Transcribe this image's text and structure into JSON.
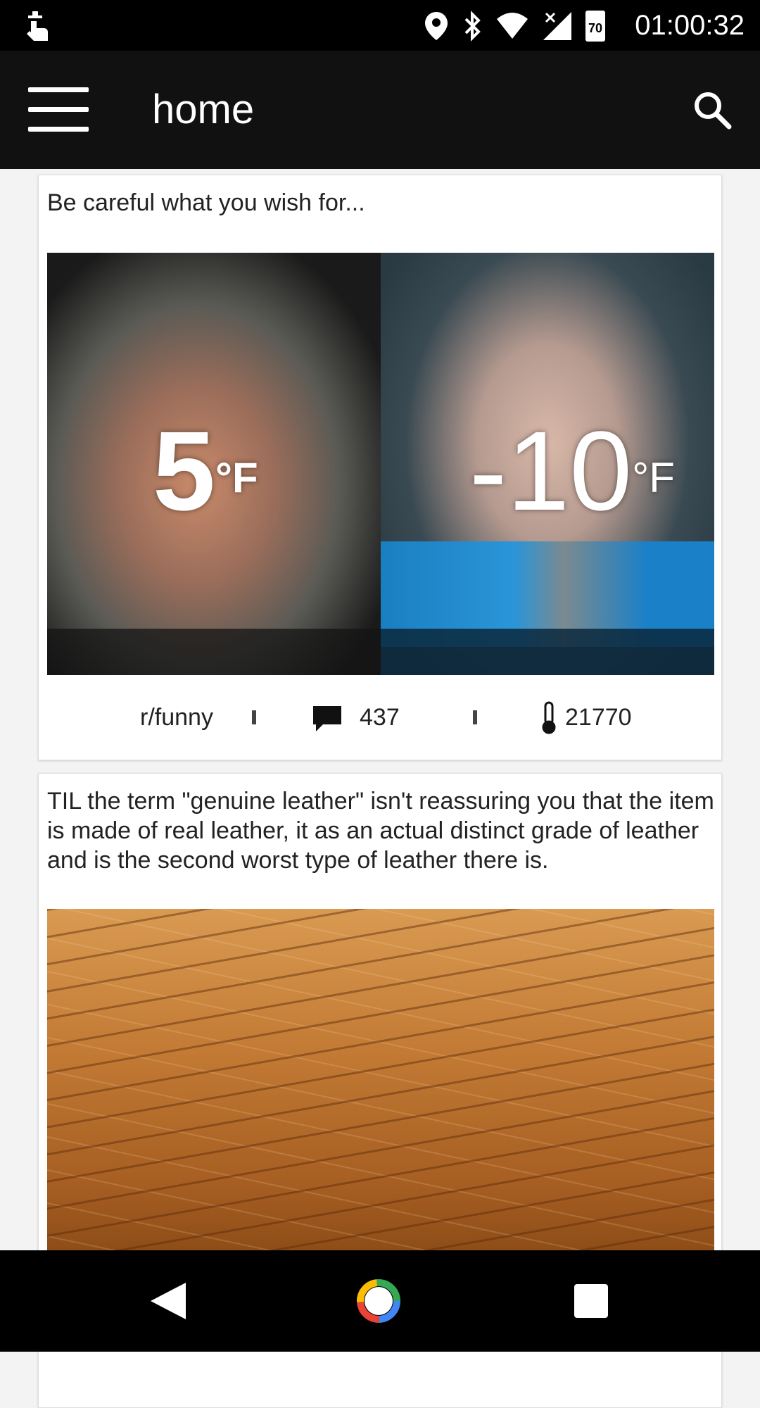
{
  "status_bar": {
    "time": "01:00:32",
    "battery_level": "70",
    "icons": [
      "touch-icon",
      "location-icon",
      "bluetooth-icon",
      "wifi-icon",
      "no-signal-icon",
      "battery-icon"
    ]
  },
  "app_bar": {
    "title": "home",
    "menu_icon": "hamburger-menu-icon",
    "search_icon": "search-icon"
  },
  "posts": [
    {
      "title": "Be careful what you wish for...",
      "image": {
        "left_temp": "5",
        "right_temp": "-10",
        "unit": "°F"
      },
      "subreddit": "r/funny",
      "comments": "437",
      "score": "21770"
    },
    {
      "title": "TIL the term \"genuine leather\" isn't reassuring you that the item is made of real leather, it as an actual distinct grade of leather and is the second worst type of leather there is."
    }
  ],
  "nav_bar": {
    "icons": [
      "back-icon",
      "home-icon",
      "recents-icon"
    ]
  },
  "colors": {
    "app_bar": "#111111",
    "status_bar": "#000000",
    "background": "#f3f3f3",
    "card": "#ffffff"
  }
}
